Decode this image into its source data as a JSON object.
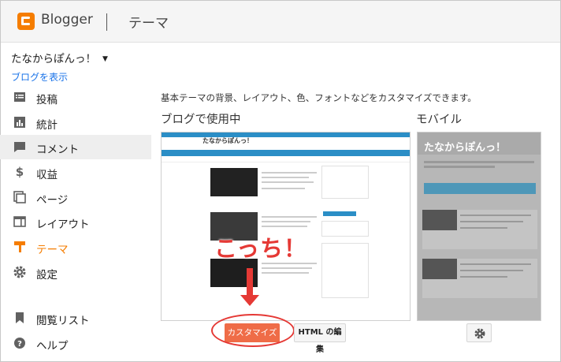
{
  "header": {
    "brand": "Blogger",
    "section_title": "テーマ",
    "colors": {
      "brand_orange": "#f57d00",
      "header_bg": "#f5f5f5"
    }
  },
  "sidebar": {
    "blog_name": "たなからぽんっ！",
    "view_blog_link": "ブログを表示",
    "items": [
      {
        "label": "投稿",
        "icon": "posts-icon"
      },
      {
        "label": "統計",
        "icon": "stats-icon"
      },
      {
        "label": "コメント",
        "icon": "comments-icon"
      },
      {
        "label": "収益",
        "icon": "earnings-icon"
      },
      {
        "label": "ページ",
        "icon": "pages-icon"
      },
      {
        "label": "レイアウト",
        "icon": "layout-icon"
      },
      {
        "label": "テーマ",
        "icon": "theme-icon"
      },
      {
        "label": "設定",
        "icon": "settings-icon"
      },
      {
        "label": "閲覧リスト",
        "icon": "reading-list-icon"
      },
      {
        "label": "ヘルプ",
        "icon": "help-icon"
      }
    ],
    "active_item": "テーマ"
  },
  "main": {
    "description": "基本テーマの背景、レイアウト、色、フォントなどをカスタマイズできます。",
    "in_use_heading": "ブログで使用中",
    "mobile_heading": "モバイル",
    "preview_blog_title": "たなからぽんっ！",
    "mobile_preview_title": "たなからぽんっ！",
    "customize_button": "カスタマイズ",
    "html_edit_button": "HTML の編集",
    "mobile_settings_icon": "gear-icon"
  },
  "annotation": {
    "text": "こっち！",
    "color": "#e53935"
  }
}
